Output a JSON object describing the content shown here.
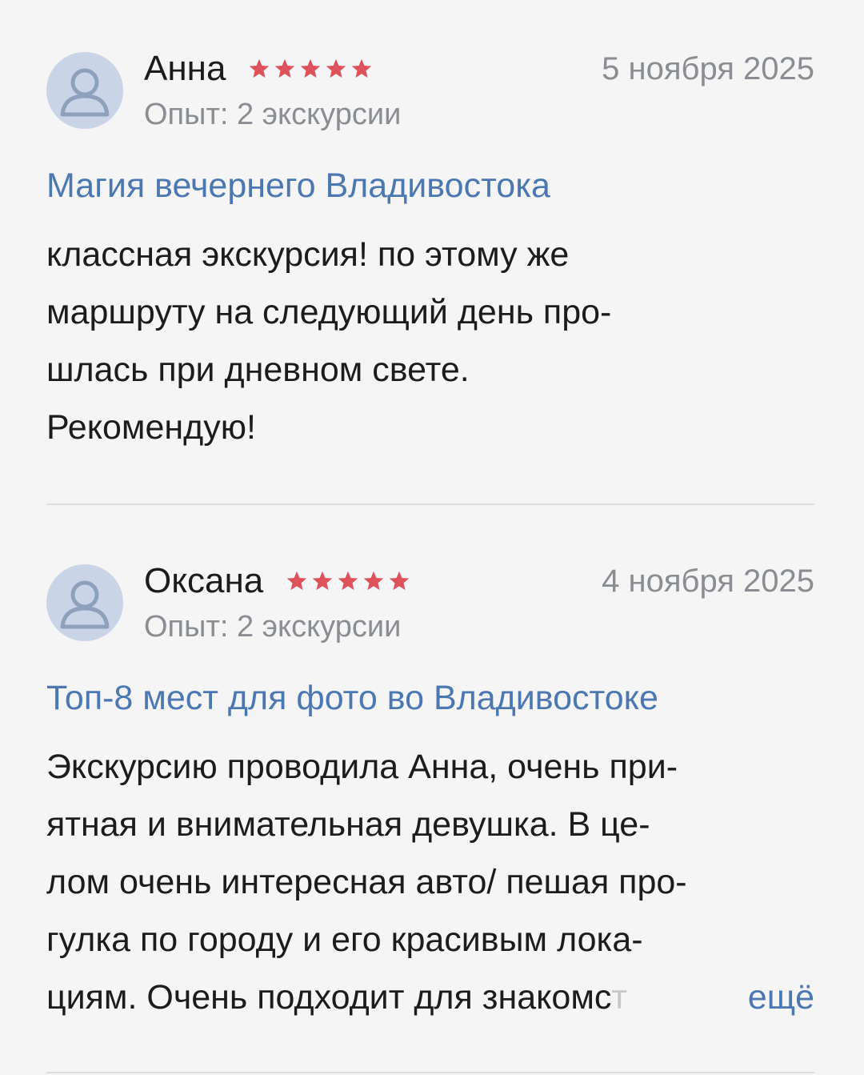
{
  "colors": {
    "background": "#f4f5f4",
    "accent_link": "#4b78b2",
    "star": "#e0525a",
    "muted_text": "#8a8d92",
    "avatar_bg": "#c9d4e7",
    "avatar_fg": "#8fa0bd"
  },
  "reviews": [
    {
      "author": "Анна",
      "rating": 5,
      "date": "5 ноября 2025",
      "experience": "Опыт: 2 экскурсии",
      "tour_title": "Магия вечернего Владивостока",
      "text_lines": [
        "классная экскурсия! по этому же",
        "маршруту на следующий день про-",
        "шлась при дневном свете.",
        "Рекомендую!"
      ],
      "avatar_icon": "user-placeholder-icon"
    },
    {
      "author": "Оксана",
      "rating": 5,
      "date": "4 ноября 2025",
      "experience": "Опыт: 2 экскурсии",
      "tour_title": "Топ-8 мест для фото во Владивостоке",
      "text_lines": [
        "Экскурсию проводила Анна, очень при-",
        "ятная и внимательная девушка. В це-",
        "лом очень интересная авто/ пешая про-",
        "гулка по городу и его красивым лока-",
        "циям. Очень подходит для знакомс"
      ],
      "text_faded_tail": "т",
      "more_label": "ещё",
      "avatar_icon": "user-placeholder-icon"
    }
  ]
}
